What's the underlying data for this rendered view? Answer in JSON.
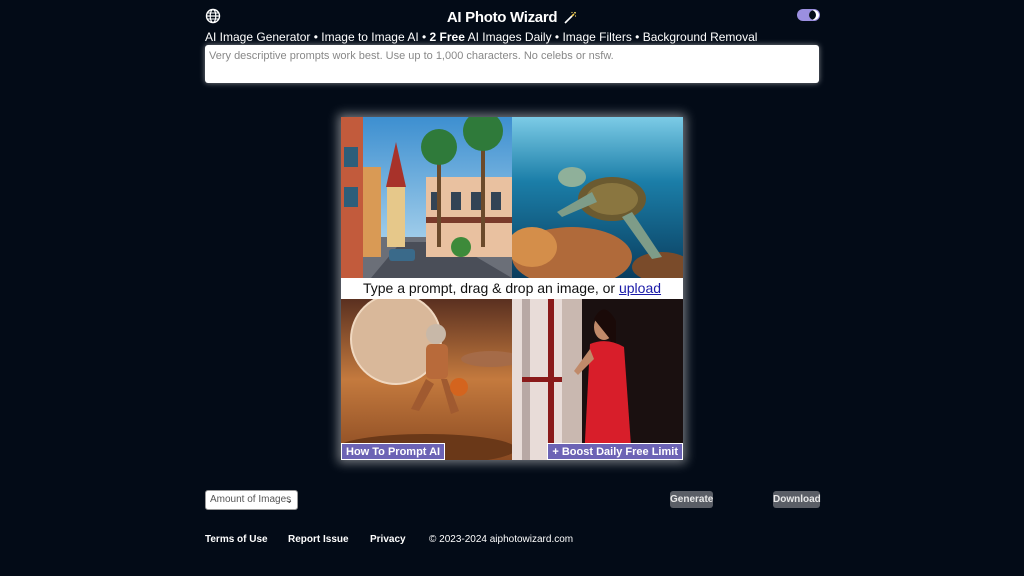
{
  "header": {
    "title": "AI Photo Wizard",
    "globe_icon": "globe-icon",
    "wand_icon": "magic-wand-icon",
    "theme_toggle": "dark-mode-toggle"
  },
  "nav": {
    "item1": "AI Image Generator",
    "sep": " • ",
    "item2": "Image to Image AI",
    "item3_bold": "2 Free",
    "item3_rest": " AI Images Daily",
    "item4": "Image Filters",
    "item5": "Background Removal"
  },
  "prompt": {
    "placeholder": "Very descriptive prompts work best. Use up to 1,000 characters. No celebs or nsfw."
  },
  "gallery": {
    "drop_text": "Type a prompt, drag & drop an image, or ",
    "upload_link": "upload",
    "howto_button": "How To Prompt AI",
    "boost_button": "+ Boost Daily Free Limit"
  },
  "controls": {
    "amount_select": "Amount of Images",
    "generate": "Generate",
    "download": "Download"
  },
  "footer": {
    "terms": "Terms of Use",
    "report": "Report Issue",
    "privacy": "Privacy",
    "copyright": "© 2023-2024 aiphotowizard.com"
  },
  "colors": {
    "background": "#030b17",
    "accent": "#6c63b5",
    "toggle": "#9b8fe0"
  }
}
